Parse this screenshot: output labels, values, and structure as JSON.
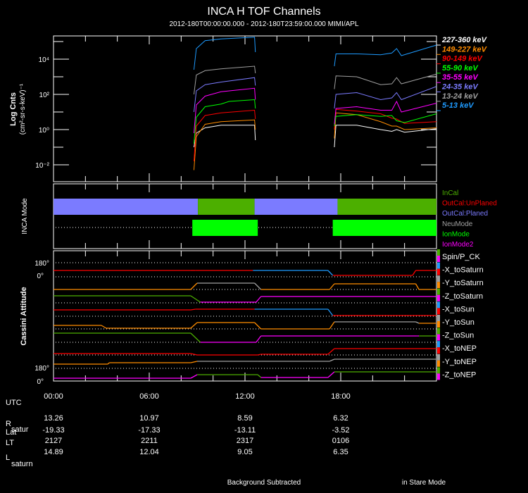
{
  "chart_data": [
    {
      "type": "line",
      "title": "INCA H TOF Channels",
      "subtitle": "2012-180T00:00:00.000 - 2012-180T23:59:00.000 MIMI/APL",
      "ylabel": "Log Cnts",
      "ylabel_units": "(cm²-sr-s-keV)⁻¹",
      "yscale": "log",
      "ylim_log10": [
        -2.96,
        5.32
      ],
      "xlim_hours": [
        0,
        24
      ],
      "y_ticks": [
        {
          "log": 4,
          "label": "10⁴"
        },
        {
          "log": 2,
          "label": "10²"
        },
        {
          "log": 0,
          "label": "10⁰"
        },
        {
          "log": -2,
          "label": "10⁻²"
        }
      ],
      "legend_position": "right",
      "series": [
        {
          "name": "227-360 keV",
          "color": "#ffffff",
          "block1": [
            [
              8.8,
              -1.0
            ],
            [
              8.95,
              -0.2
            ],
            [
              9.5,
              0.1
            ],
            [
              10.5,
              0.25
            ],
            [
              12.6,
              0.25
            ],
            [
              12.65,
              -0.6
            ]
          ],
          "block2": [
            [
              17.6,
              -1.0
            ],
            [
              17.7,
              0.25
            ],
            [
              19,
              0.25
            ],
            [
              20.5,
              0.0
            ],
            [
              21.2,
              -0.1
            ],
            [
              21.5,
              0.0
            ],
            [
              22,
              -0.15
            ],
            [
              24,
              0.05
            ]
          ]
        },
        {
          "name": "149-227 keV",
          "color": "#ff8c00",
          "block1": [
            [
              8.8,
              -2.3
            ],
            [
              8.95,
              -0.4
            ],
            [
              9.5,
              0.3
            ],
            [
              10.5,
              0.45
            ],
            [
              12.6,
              0.55
            ],
            [
              12.65,
              0.0
            ]
          ],
          "block2": [
            [
              17.6,
              -0.5
            ],
            [
              17.7,
              0.95
            ],
            [
              19,
              0.85
            ],
            [
              20.5,
              0.45
            ],
            [
              21.2,
              0.2
            ],
            [
              21.5,
              0.2
            ],
            [
              22,
              0.0
            ],
            [
              24,
              0.1
            ]
          ]
        },
        {
          "name": "90-149 keV",
          "color": "#ff0000",
          "block1": [
            [
              8.8,
              -1.8
            ],
            [
              8.95,
              0.2
            ],
            [
              9.5,
              0.8
            ],
            [
              10.5,
              0.95
            ],
            [
              12.6,
              1.1
            ],
            [
              12.65,
              0.6
            ]
          ],
          "block2": [
            [
              17.6,
              0.0
            ],
            [
              17.7,
              1.15
            ],
            [
              19,
              1.05
            ],
            [
              20.5,
              0.9
            ],
            [
              21.2,
              0.65
            ],
            [
              21.5,
              0.6
            ],
            [
              22,
              0.35
            ],
            [
              24,
              0.45
            ]
          ]
        },
        {
          "name": "55-90 keV",
          "color": "#00ff00",
          "block1": [
            [
              8.8,
              -0.8
            ],
            [
              8.95,
              0.7
            ],
            [
              9.5,
              1.3
            ],
            [
              10.5,
              1.45
            ],
            [
              11,
              1.6
            ],
            [
              12.6,
              1.7
            ],
            [
              12.65,
              1.2
            ]
          ],
          "block2": [
            [
              17.6,
              0.2
            ],
            [
              17.7,
              0.75
            ],
            [
              19,
              0.85
            ],
            [
              20.5,
              0.75
            ],
            [
              21.2,
              0.8
            ],
            [
              21.5,
              0.5
            ],
            [
              22,
              0.4
            ],
            [
              24,
              0.9
            ]
          ]
        },
        {
          "name": "35-55 keV",
          "color": "#ff00ff",
          "block1": [
            [
              8.8,
              -0.2
            ],
            [
              8.95,
              1.4
            ],
            [
              9.5,
              1.9
            ],
            [
              10.5,
              2.15
            ],
            [
              12.6,
              2.35
            ],
            [
              12.65,
              1.7
            ]
          ],
          "block2": [
            [
              17.6,
              0.3
            ],
            [
              17.7,
              1.2
            ],
            [
              19,
              1.3
            ],
            [
              20.5,
              1.1
            ],
            [
              21.2,
              1.1
            ],
            [
              21.5,
              1.6
            ],
            [
              21.8,
              1.0
            ],
            [
              24,
              1.5
            ]
          ]
        },
        {
          "name": "24-35 keV",
          "color": "#7b7bff",
          "block1": [
            [
              8.8,
              1.0
            ],
            [
              8.95,
              2.2
            ],
            [
              9.5,
              2.55
            ],
            [
              10.5,
              2.7
            ],
            [
              12.6,
              2.95
            ],
            [
              12.65,
              2.5
            ]
          ],
          "block2": [
            [
              17.6,
              1.2
            ],
            [
              17.7,
              2.0
            ],
            [
              19,
              2.1
            ],
            [
              20.5,
              1.7
            ],
            [
              21.2,
              1.8
            ],
            [
              21.5,
              2.1
            ],
            [
              21.8,
              1.7
            ],
            [
              24,
              2.45
            ]
          ]
        },
        {
          "name": "13-24 keV",
          "color": "#a0a0a0",
          "block1": [
            [
              8.8,
              2.0
            ],
            [
              8.95,
              3.1
            ],
            [
              9.5,
              3.35
            ],
            [
              10.5,
              3.45
            ],
            [
              12.6,
              3.6
            ],
            [
              12.65,
              3.2
            ]
          ],
          "block2": [
            [
              17.6,
              2.3
            ],
            [
              17.7,
              3.05
            ],
            [
              19,
              3.0
            ],
            [
              20.5,
              2.55
            ],
            [
              21.2,
              2.6
            ],
            [
              21.5,
              2.95
            ],
            [
              21.8,
              2.6
            ],
            [
              24,
              3.15
            ]
          ]
        },
        {
          "name": "5-13 keV",
          "color": "#1e9bff",
          "block1": [
            [
              8.8,
              3.4
            ],
            [
              8.95,
              4.6
            ],
            [
              9.5,
              5.05
            ],
            [
              10.5,
              5.15
            ],
            [
              12.6,
              5.25
            ],
            [
              12.65,
              4.4
            ]
          ],
          "block2": [
            [
              17.6,
              3.6
            ],
            [
              17.7,
              4.3
            ],
            [
              19,
              4.3
            ],
            [
              20.5,
              4.25
            ],
            [
              21.2,
              4.35
            ],
            [
              21.5,
              4.6
            ],
            [
              21.8,
              4.2
            ],
            [
              24,
              4.8
            ]
          ]
        }
      ]
    },
    {
      "type": "timeline",
      "ylabel": "INCA Mode",
      "legend": [
        {
          "name": "InCal",
          "color": "#4caf00"
        },
        {
          "name": "OutCal:UnPlaned",
          "color": "#ff0000"
        },
        {
          "name": "OutCal:Planed",
          "color": "#7b7bff"
        },
        {
          "name": "NeuMode",
          "color": "#a0a0a0"
        },
        {
          "name": "IonMode",
          "color": "#00ff00"
        },
        {
          "name": "IonMode2",
          "color": "#ff00ff"
        }
      ],
      "cal_row": [
        {
          "start": 0,
          "end": 9.05,
          "state": "OutCal:Planed",
          "color": "#7b7bff"
        },
        {
          "start": 9.05,
          "end": 12.6,
          "state": "InCal",
          "color": "#4caf00"
        },
        {
          "start": 12.6,
          "end": 17.8,
          "state": "OutCal:Planed",
          "color": "#7b7bff"
        },
        {
          "start": 17.8,
          "end": 24,
          "state": "InCal",
          "color": "#4caf00"
        }
      ],
      "mode_row": [
        {
          "start": 8.7,
          "end": 12.8,
          "state": "IonMode",
          "color": "#00ff00"
        },
        {
          "start": 17.5,
          "end": 24,
          "state": "IonMode",
          "color": "#00ff00"
        }
      ]
    },
    {
      "type": "line",
      "ylabel": "Cassini Attitude",
      "y_ticks_top": [
        "180°",
        "0°"
      ],
      "y_ticks_bottom": [
        "180°",
        "0°"
      ],
      "legend": [
        {
          "name": "Spin/P_CK",
          "colors": [
            "#4caf00",
            "#ff00ff"
          ]
        },
        {
          "name": "-X_toSaturn",
          "colors": [
            "#1e9bff",
            "#ff0000"
          ]
        },
        {
          "name": "-Y_toSaturn",
          "colors": [
            "#a0a0a0",
            "#ff8c00"
          ]
        },
        {
          "name": "-Z_toSaturn",
          "colors": [
            "#4caf00",
            "#ff00ff"
          ]
        },
        {
          "name": "-X_toSun",
          "colors": [
            "#1e9bff",
            "#ff0000"
          ]
        },
        {
          "name": "-Y_toSun",
          "colors": [
            "#a0a0a0",
            "#ff8c00"
          ]
        },
        {
          "name": "-Z_toSun",
          "colors": [
            "#4caf00",
            "#ff00ff"
          ]
        },
        {
          "name": "-X_toNEP",
          "colors": [
            "#1e9bff",
            "#ff0000"
          ]
        },
        {
          "name": "-Y_toNEP",
          "colors": [
            "#a0a0a0",
            "#ff8c00"
          ]
        },
        {
          "name": "-Z_toNEP",
          "colors": [
            "#4caf00",
            "#ff00ff"
          ]
        }
      ],
      "traces_deg": [
        {
          "name": "-X_toSaturn",
          "segments": [
            [
              0,
              8.6,
              81,
              "#ff0000"
            ],
            [
              8.9,
              12.4,
              81,
              "#ff0000"
            ],
            [
              12.5,
              17.2,
              81,
              "#1e9bff"
            ],
            [
              17.5,
              22.5,
              18,
              "#ff0000"
            ],
            [
              22.7,
              24,
              81,
              "#ff0000"
            ]
          ]
        },
        {
          "name": "-Y_toSaturn",
          "segments": [
            [
              0,
              8.6,
              0,
              "#ff8c00"
            ],
            [
              9.0,
              12.6,
              81,
              "#a0a0a0"
            ],
            [
              13.0,
              17.3,
              0,
              "#ff8c00"
            ],
            [
              17.6,
              22.7,
              72,
              "#ff8c00"
            ],
            [
              22.9,
              24,
              0,
              "#ff8c00"
            ]
          ]
        },
        {
          "name": "-Z_toSaturn",
          "segments": [
            [
              0,
              8.6,
              90,
              "#4caf00"
            ],
            [
              9.2,
              12.7,
              9,
              "#ff00ff"
            ],
            [
              13.0,
              24,
              81,
              "#ff00ff"
            ]
          ]
        },
        {
          "name": "-X_toSun",
          "segments": [
            [
              0,
              8.6,
              81,
              "#ff0000"
            ],
            [
              8.9,
              12.6,
              90,
              "#ff0000"
            ],
            [
              12.6,
              17.2,
              90,
              "#1e9bff"
            ],
            [
              17.5,
              24,
              9,
              "#ff0000"
            ]
          ]
        },
        {
          "name": "-Y_toSun",
          "segments": [
            [
              0,
              3.0,
              45,
              "#ff8c00"
            ],
            [
              3.3,
              8.6,
              9,
              "#ff8c00"
            ],
            [
              9.0,
              12.6,
              81,
              "#ff8c00"
            ],
            [
              13.0,
              17.3,
              0,
              "#ff8c00"
            ],
            [
              17.6,
              22.7,
              90,
              "#a0a0a0"
            ],
            [
              22.9,
              24,
              72,
              "#ff8c00"
            ]
          ]
        },
        {
          "name": "-Z_toSun",
          "segments": [
            [
              0,
              8.6,
              117,
              "#4caf00"
            ],
            [
              9.2,
              12.7,
              0,
              "#ff00ff"
            ],
            [
              13.0,
              22.8,
              81,
              "#ff00ff"
            ],
            [
              22.9,
              24,
              81,
              "#4caf00"
            ]
          ]
        },
        {
          "name": "-X_toNEP",
          "segments": [
            [
              0,
              8.6,
              18,
              "#ff0000"
            ],
            [
              9.0,
              12.8,
              0,
              "#ff0000"
            ],
            [
              13.0,
              17.2,
              9,
              "#ff0000"
            ],
            [
              17.6,
              24,
              81,
              "#ff0000"
            ]
          ]
        },
        {
          "name": "-Y_toNEP",
          "segments": [
            [
              0,
              3.4,
              54,
              "#ff8c00"
            ],
            [
              3.5,
              8.6,
              72,
              "#ff8c00"
            ],
            [
              9.0,
              12.8,
              90,
              "#a0a0a0"
            ],
            [
              13.0,
              17.3,
              90,
              "#a0a0a0"
            ],
            [
              17.6,
              24,
              117,
              "#a0a0a0"
            ]
          ]
        },
        {
          "name": "-Z_toNEP",
          "segments": [
            [
              0,
              8.6,
              36,
              "#ff00ff"
            ],
            [
              9.0,
              12.8,
              81,
              "#4caf00"
            ],
            [
              13.0,
              17.2,
              45,
              "#ff00ff"
            ],
            [
              17.6,
              24,
              117,
              "#4caf00"
            ]
          ]
        }
      ]
    }
  ],
  "ephemeris": {
    "utc_label": "UTC",
    "times": [
      "00:00",
      "06:00",
      "12:00",
      "18:00"
    ],
    "rows": [
      {
        "label": "R",
        "sub": "satur",
        "values": [
          "13.26",
          "10.97",
          "8.59",
          "6.32"
        ]
      },
      {
        "label": "Lat",
        "sub": "",
        "values": [
          "-19.33",
          "-17.33",
          "-13.11",
          "-3.52"
        ]
      },
      {
        "label": "LT",
        "sub": "",
        "values": [
          "2127",
          "2211",
          "2317",
          "0106"
        ]
      },
      {
        "label": "L",
        "sub": "saturn",
        "values": [
          "14.89",
          "12.04",
          "9.05",
          "6.35"
        ]
      }
    ]
  },
  "footer": {
    "left": "Background Subtracted",
    "right": "in Stare Mode"
  }
}
